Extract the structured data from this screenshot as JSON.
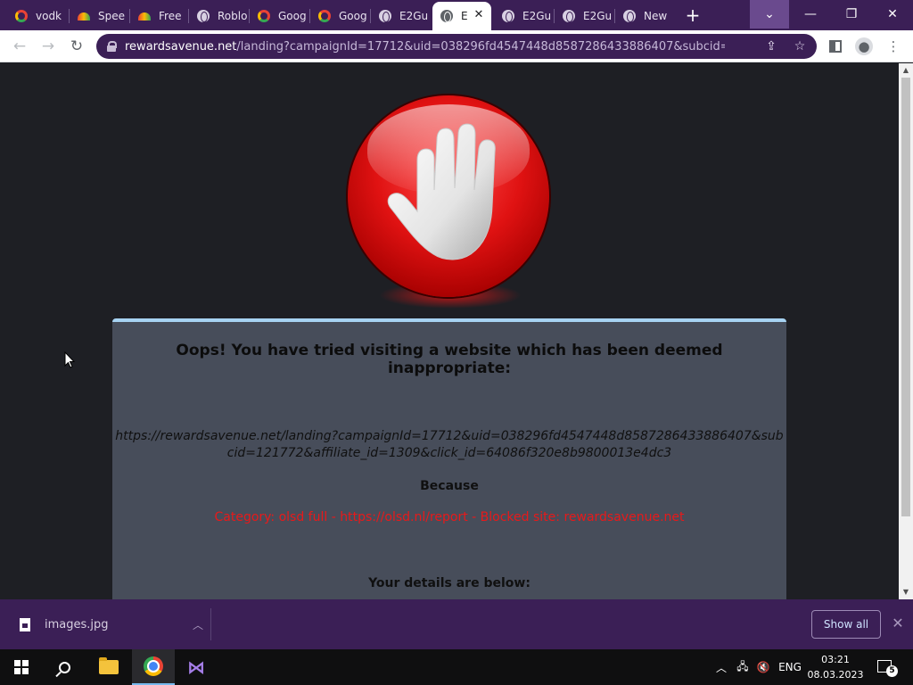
{
  "browser": {
    "tabs": [
      {
        "label": "vodk",
        "icon": "google-icon"
      },
      {
        "label": "Spee",
        "icon": "speedtest-icon"
      },
      {
        "label": "Free",
        "icon": "speedtest-icon"
      },
      {
        "label": "Roblo",
        "icon": "globe-icon"
      },
      {
        "label": "Goog",
        "icon": "google-icon"
      },
      {
        "label": "Goog",
        "icon": "google-icon"
      },
      {
        "label": "E2Gu",
        "icon": "globe-icon"
      },
      {
        "label": "E",
        "icon": "globe-icon",
        "active": true
      },
      {
        "label": "E2Gu",
        "icon": "globe-icon"
      },
      {
        "label": "E2Gu",
        "icon": "globe-icon"
      },
      {
        "label": "New",
        "icon": "chrome-icon"
      }
    ],
    "new_tab_symbol": "+",
    "window_controls": {
      "tab_search": "⌄",
      "minimize": "—",
      "maximize": "❐",
      "close": "✕"
    },
    "nav": {
      "back": "←",
      "forward": "→",
      "reload": "↻"
    },
    "address": {
      "host": "rewardsavenue.net",
      "path": "/landing?campaignId=17712&uid=038296fd4547448d8587286433886407&subcid=121772&..."
    },
    "accent_color": "#3b1f56"
  },
  "page": {
    "title": "Oops! You have tried visiting a website which has been deemed inappropriate:",
    "blocked_url": "https://rewardsavenue.net/landing?campaignId=17712&uid=038296fd4547448d8587286433886407&subcid=121772&affiliate_id=1309&click_id=64086f320e8b9800013e4dc3",
    "because_label": "Because",
    "reason": "Category: olsd full - https://olsd.nl/report - Blocked site: rewardsavenue.net",
    "details_label": "Your details are below:",
    "reason_color": "#e8191a",
    "panel_color": "#474d5a"
  },
  "downloads": {
    "file_name": "images.jpg",
    "show_all_label": "Show all",
    "close_symbol": "✕"
  },
  "taskbar": {
    "language": "ENG",
    "time": "03:21",
    "date": "08.03.2023",
    "notification_count": "5"
  }
}
